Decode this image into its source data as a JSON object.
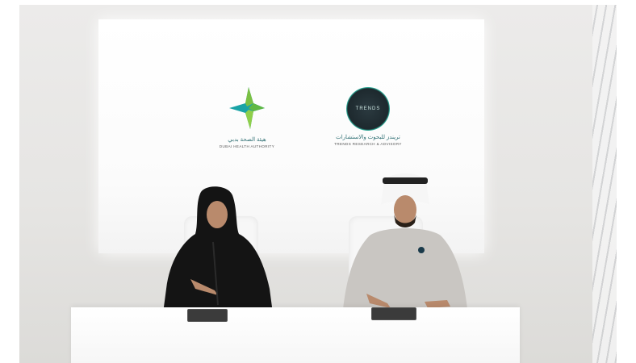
{
  "scene": {
    "description_icons": [
      "dha-logo-icon",
      "trends-logo-icon"
    ],
    "colors": {
      "dha_green": "#7ac043",
      "dha_teal": "#1aa3a6",
      "trends_teal": "#2fb6a1",
      "abaya": "#141414",
      "kandura": "#c9c6c2"
    }
  },
  "logos": {
    "dha_arabic": "هيئة الصحة بدبي",
    "dha_english": "DUBAI HEALTH AUTHORITY",
    "trends_word": "TRENDS",
    "trends_arabic": "تريندز للبحوث والاستشارات",
    "trends_english": "TRENDS RESEARCH & ADVISORY"
  }
}
